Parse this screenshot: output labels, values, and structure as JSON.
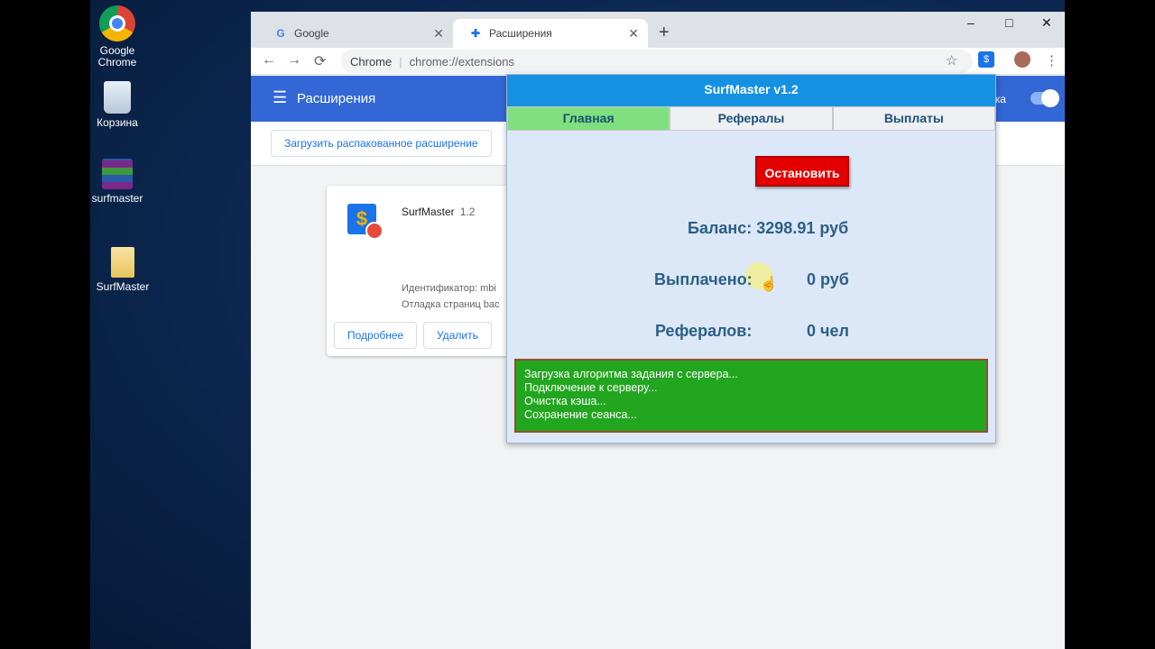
{
  "desktop": {
    "icons": [
      {
        "label": "Google Chrome"
      },
      {
        "label": "Корзина"
      },
      {
        "label": "surfmaster"
      },
      {
        "label": "SurfMaster"
      }
    ]
  },
  "browser": {
    "tabs": [
      {
        "label": "Google",
        "icon": "google-icon"
      },
      {
        "label": "Расширения",
        "icon": "puzzle-icon"
      }
    ],
    "new_tab": "+",
    "window_controls": {
      "minimize": "–",
      "maximize": "□",
      "close": "✕"
    },
    "omnibox": {
      "site": "Chrome",
      "url": "chrome://extensions"
    },
    "nav": {
      "back": "←",
      "forward": "→",
      "reload": "⟳"
    },
    "star": "☆",
    "menu": "⋮"
  },
  "extensions_page": {
    "menu_icon": "☰",
    "title": "Расширения",
    "dev_mode_label": "ика",
    "load_unpacked": "Загрузить распакованное расширение",
    "card": {
      "name": "SurfMaster",
      "version": "1.2",
      "id_label": "Идентификатор: mbi",
      "debug_label": "Отладка страниц bac",
      "details_button": "Подробнее",
      "remove_button": "Удалить"
    }
  },
  "popup": {
    "title": "SurfMaster v1.2",
    "tabs": [
      {
        "label": "Главная",
        "active": true
      },
      {
        "label": "Рефералы",
        "active": false
      },
      {
        "label": "Выплаты",
        "active": false
      }
    ],
    "stop_button": "Остановить",
    "balance": "Баланс: 3298.91 руб",
    "paid_label": "Выплачено:",
    "paid_value": "0 руб",
    "referrals_label": "Рефералов:",
    "referrals_value": "0 чел",
    "log": [
      "Загрузка алгоритма задания с сервера...",
      "Подключение к серверу...",
      "Очистка кэша...",
      "Сохранение сеанса..."
    ],
    "colors": {
      "title_bar": "#1591e3",
      "active_tab": "#7ee07e",
      "stop_button": "#e50000",
      "log_bg": "#22a51f"
    }
  }
}
